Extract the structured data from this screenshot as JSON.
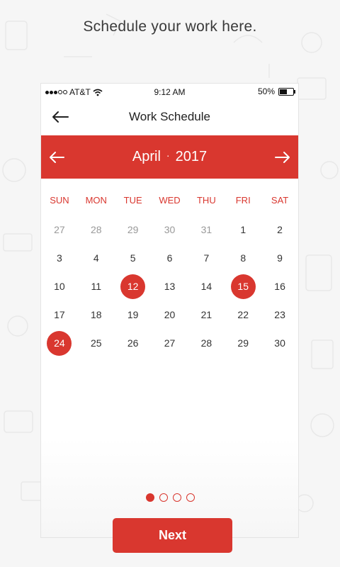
{
  "headline": "Schedule your work here.",
  "status_bar": {
    "carrier": "AT&T",
    "time": "9:12 AM",
    "battery": "50%"
  },
  "nav": {
    "title": "Work Schedule"
  },
  "calendar": {
    "month": "April",
    "year": "2017",
    "separator": "·",
    "weekdays": [
      "SUN",
      "MON",
      "TUE",
      "WED",
      "THU",
      "FRI",
      "SAT"
    ],
    "days": [
      {
        "d": "27",
        "muted": true
      },
      {
        "d": "28",
        "muted": true
      },
      {
        "d": "29",
        "muted": true
      },
      {
        "d": "30",
        "muted": true
      },
      {
        "d": "31",
        "muted": true
      },
      {
        "d": "1"
      },
      {
        "d": "2"
      },
      {
        "d": "3"
      },
      {
        "d": "4"
      },
      {
        "d": "5"
      },
      {
        "d": "6"
      },
      {
        "d": "7"
      },
      {
        "d": "8"
      },
      {
        "d": "9"
      },
      {
        "d": "10"
      },
      {
        "d": "11"
      },
      {
        "d": "12",
        "selected": true
      },
      {
        "d": "13"
      },
      {
        "d": "14"
      },
      {
        "d": "15",
        "selected": true
      },
      {
        "d": "16"
      },
      {
        "d": "17"
      },
      {
        "d": "18"
      },
      {
        "d": "19"
      },
      {
        "d": "20"
      },
      {
        "d": "21"
      },
      {
        "d": "22"
      },
      {
        "d": "23"
      },
      {
        "d": "24",
        "selected": true
      },
      {
        "d": "25"
      },
      {
        "d": "26"
      },
      {
        "d": "27"
      },
      {
        "d": "28"
      },
      {
        "d": "29"
      },
      {
        "d": "30"
      }
    ]
  },
  "pager": {
    "total": 4,
    "active": 0
  },
  "next_button": "Next",
  "colors": {
    "accent": "#d9372f",
    "background": "#f6f6f6"
  },
  "icons": {
    "back": "arrow-left-icon",
    "prev_month": "arrow-left-icon",
    "next_month": "arrow-right-icon",
    "wifi": "wifi-icon",
    "battery": "battery-icon"
  }
}
